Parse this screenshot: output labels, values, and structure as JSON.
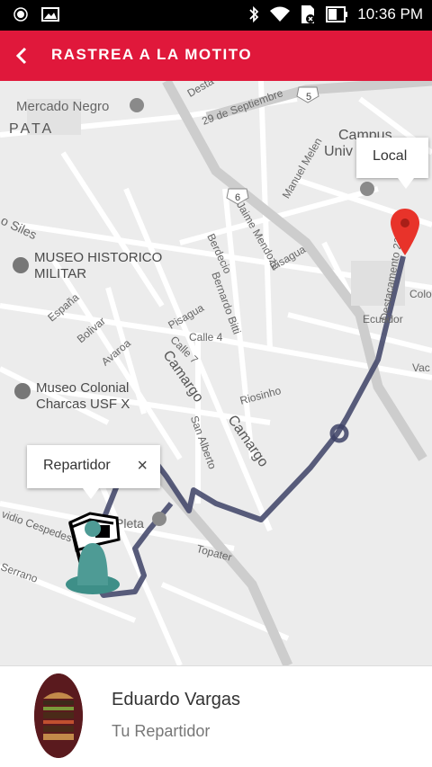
{
  "status_bar": {
    "time": "10:36 PM"
  },
  "app_bar": {
    "title": "RASTREA A LA MOTITO"
  },
  "map": {
    "labels": {
      "mercado": "Mercado Negro",
      "apata": "PATA",
      "campus": "Campus",
      "univ": "Univ",
      "sept": "29 de Septiembre",
      "desta": "Desta",
      "siles": "o Siles",
      "museo_hist_1": "MUSEO HISTORICO",
      "museo_hist_2": "MILITAR",
      "espana": "España",
      "bolivar": "Bolivar",
      "avaroa": "Avaroa",
      "pisagua1": "Pisagua",
      "calle4": "Calle 4",
      "calle7": "Calle 7",
      "berdecio": "Berdecio",
      "bernardo": "Bernardo Bitti",
      "jaime": "Jaime Mendoza",
      "pisagua2": "Pisagua",
      "manuel": "Manuel Melen",
      "destacamento": "Destacamento 220",
      "ecuador": "Ecuador",
      "colo": "Colo",
      "vac": "Vac",
      "camargo1": "Camargo",
      "camargo2": "Camargo",
      "riosinho": "Riosinho",
      "museo_col_1": "Museo Colonial",
      "museo_col_2": "Charcas USF X",
      "san_alberto": "San Alberto",
      "topater": "Topater",
      "cespedes": "vidio Cespedes",
      "serrano": "Serrano",
      "pleta": "Pleta",
      "route5": "5",
      "route6": "6"
    },
    "local_bubble": "Local",
    "repartidor_bubble": "Repartidor",
    "close_symbol": "×"
  },
  "driver": {
    "name": "Eduardo Vargas",
    "role": "Tu Repartidor"
  },
  "colors": {
    "accent": "#e0183b",
    "route": "#3d4266",
    "pin": "#e8332a"
  }
}
